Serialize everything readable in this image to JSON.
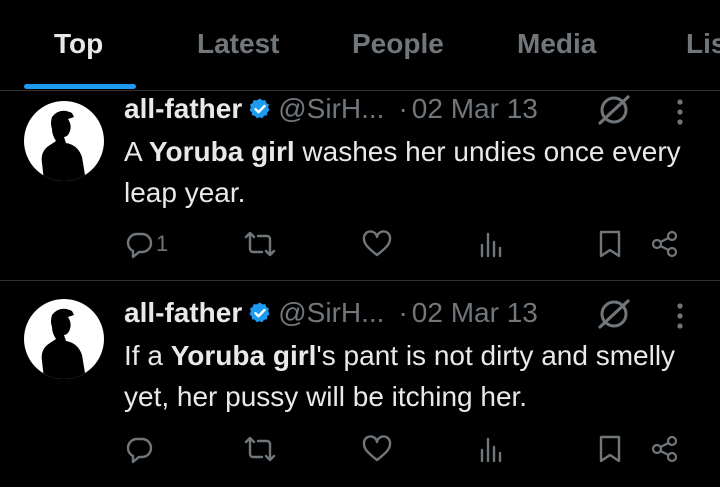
{
  "tabs": [
    {
      "label": "Top",
      "active": true
    },
    {
      "label": "Latest"
    },
    {
      "label": "People"
    },
    {
      "label": "Media"
    },
    {
      "label": "Lis"
    }
  ],
  "tweets": [
    {
      "name": "all-father",
      "handle": "@SirH...",
      "dot": "·",
      "date": "02 Mar 13",
      "text_parts": [
        "A ",
        "Yoruba girl",
        " washes her undies once every leap year."
      ],
      "reply_count": "1"
    },
    {
      "name": "all-father",
      "handle": "@SirH...",
      "dot": "·",
      "date": "02 Mar 13",
      "text_parts": [
        "If a ",
        "Yoruba girl",
        "'s pant is not dirty and smelly yet, her pussy will be itching her."
      ],
      "reply_count": ""
    }
  ],
  "colors": {
    "accent": "#1d9bf0",
    "muted": "#71767b",
    "text": "#e7e9ea",
    "background": "#000000",
    "divider": "#2f3336"
  },
  "icons": [
    "verified-badge-icon",
    "grok-icon",
    "more-icon",
    "reply-icon",
    "retweet-icon",
    "like-icon",
    "views-icon",
    "bookmark-icon",
    "share-icon"
  ]
}
